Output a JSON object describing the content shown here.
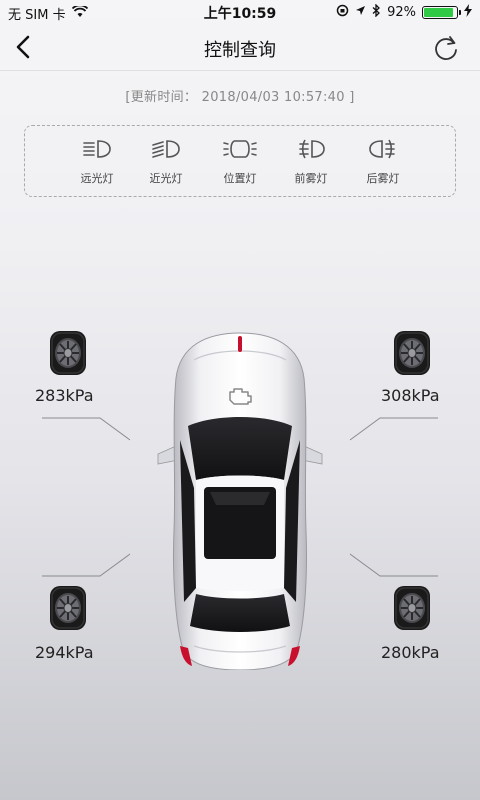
{
  "status_bar": {
    "carrier": "无 SIM 卡",
    "time": "上午10:59",
    "battery_percent": "92%",
    "battery_level": 0.92,
    "icons": [
      "wifi-icon",
      "orientation-lock-icon",
      "location-icon",
      "bluetooth-icon",
      "battery-icon"
    ]
  },
  "nav": {
    "title": "控制查询",
    "back_icon": "chevron-left-icon",
    "refresh_icon": "refresh-icon"
  },
  "update_time": "[更新时间： 2018/04/03 10:57:40 ]",
  "lights": [
    {
      "label": "远光灯",
      "icon": "high-beam-icon"
    },
    {
      "label": "近光灯",
      "icon": "low-beam-icon"
    },
    {
      "label": "位置灯",
      "icon": "position-light-icon"
    },
    {
      "label": "前雾灯",
      "icon": "front-fog-light-icon"
    },
    {
      "label": "后雾灯",
      "icon": "rear-fog-light-icon"
    }
  ],
  "tires": {
    "front_left": "283kPa",
    "front_right": "308kPa",
    "rear_left": "294kPa",
    "rear_right": "280kPa"
  },
  "colors": {
    "accent_red": "#c8102e",
    "battery_green": "#2fc946"
  }
}
